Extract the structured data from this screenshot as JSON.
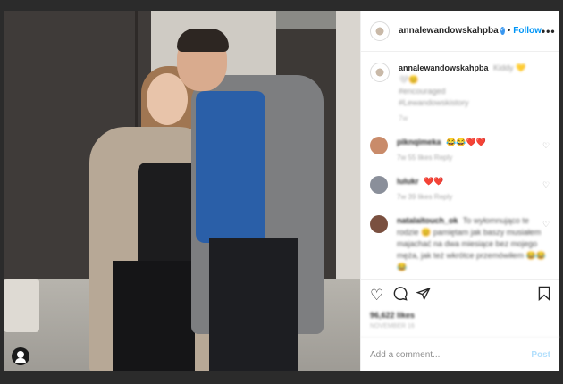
{
  "post": {
    "header": {
      "username": "annalewandowskahpba",
      "follow_label": "Follow",
      "more_icon": "more-options-icon",
      "separator": "•"
    },
    "caption": {
      "username": "annalewandowskahpba",
      "text_line1": "Kiddy 💛",
      "text_line2": "🤍😊",
      "text_line3": "#encouraged",
      "text_line4": "#Lewandowskistory",
      "time": "7w"
    },
    "comments": [
      {
        "username": "piknqimeka",
        "text": "😂😂❤️❤️",
        "meta": "7w   55 likes   Reply",
        "avatar_color": "#c98b6a"
      },
      {
        "username": "lulukr",
        "text": "❤️❤️",
        "meta": "7w   39 likes   Reply",
        "avatar_color": "#8a8f9a"
      },
      {
        "username": "natalaitouch_ok",
        "text": "To wyłomnująco te rodzie 😊 pamiętam jak baszy musiałem majachać na dwa miesiące bez mojego męża, jak też wkrótce przemówiłem 😂😂😂",
        "meta": "",
        "avatar_color": "#7a5040"
      }
    ],
    "actions": {
      "like_icon": "heart-icon",
      "comment_icon": "comment-icon",
      "share_icon": "share-icon",
      "save_icon": "bookmark-icon"
    },
    "likes": "96,622 likes",
    "date": "NOVEMBER 16",
    "add_comment": {
      "placeholder": "Add a comment...",
      "post_label": "Post"
    }
  },
  "colors": {
    "accent": "#0095f6",
    "verified": "#3897f0",
    "post_disabled": "#b2dffc"
  }
}
